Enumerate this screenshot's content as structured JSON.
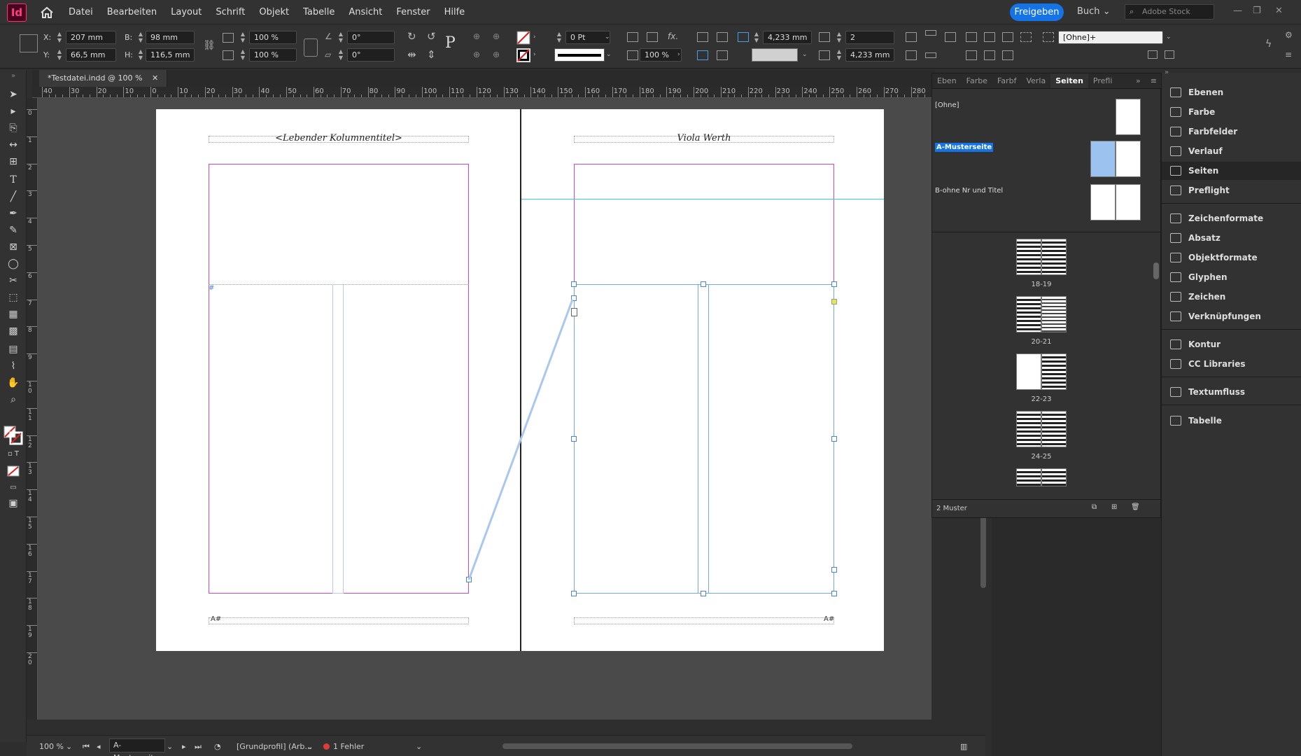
{
  "app": {
    "logo": "Id"
  },
  "menu": [
    "Datei",
    "Bearbeiten",
    "Layout",
    "Schrift",
    "Objekt",
    "Tabelle",
    "Ansicht",
    "Fenster",
    "Hilfe"
  ],
  "header": {
    "share_label": "Freigeben",
    "workspace": "Buch",
    "stock_placeholder": "Adobe Stock"
  },
  "control": {
    "x_label": "X:",
    "x_value": "207 mm",
    "y_label": "Y:",
    "y_value": "66,5 mm",
    "w_label": "B:",
    "w_value": "98 mm",
    "h_label": "H:",
    "h_value": "116,5 mm",
    "scale_x": "100 %",
    "scale_y": "100 %",
    "rotate": "0°",
    "shear": "0°",
    "stroke_weight": "0 Pt",
    "opacity": "100 %",
    "gutter1": "4,233 mm",
    "columns": "2",
    "gutter2": "4,233 mm",
    "object_style": "[Ohne]+"
  },
  "document": {
    "tab_title": "*Testdatei.indd @ 100 %"
  },
  "ruler": {
    "h": [
      "40",
      "30",
      "20",
      "10",
      "0",
      "10",
      "20",
      "30",
      "40",
      "50",
      "60",
      "70",
      "80",
      "90",
      "100",
      "110",
      "120",
      "130",
      "140",
      "150",
      "160",
      "170",
      "180",
      "190",
      "200",
      "210",
      "220",
      "230",
      "240",
      "250",
      "260",
      "270",
      "280",
      "29"
    ],
    "v": [
      "0",
      "1",
      "2",
      "3",
      "4",
      "5",
      "6",
      "7",
      "8",
      "9",
      "10",
      "11",
      "12",
      "13",
      "14",
      "15",
      "16",
      "17",
      "18",
      "19",
      "20"
    ]
  },
  "spread": {
    "left_header": "<Lebender Kolumnentitel>",
    "right_header": "Viola Werth"
  },
  "pages_panel": {
    "tabs": [
      "Eben",
      "Farbe",
      "Farbf",
      "Verla",
      "Seiten",
      "Prefli"
    ],
    "active_tab": "Seiten",
    "masters": [
      "[Ohne]",
      "A-Musterseite",
      "B-ohne Nr und Titel"
    ],
    "spreads": [
      "18-19",
      "20-21",
      "22-23",
      "24-25"
    ],
    "footer": "2 Muster"
  },
  "dock": [
    "Ebenen",
    "Farbe",
    "Farbfelder",
    "Verlauf",
    "Seiten",
    "Preflight",
    "Zeichenformate",
    "Absatz",
    "Objektformate",
    "Glyphen",
    "Zeichen",
    "Verknüpfungen",
    "Kontur",
    "CC Libraries",
    "Textumfluss",
    "Tabelle"
  ],
  "status": {
    "zoom": "100 %",
    "page": "A-Musterseite",
    "profile": "[Grundprofil] (Arb...",
    "errors": "1 Fehler"
  }
}
